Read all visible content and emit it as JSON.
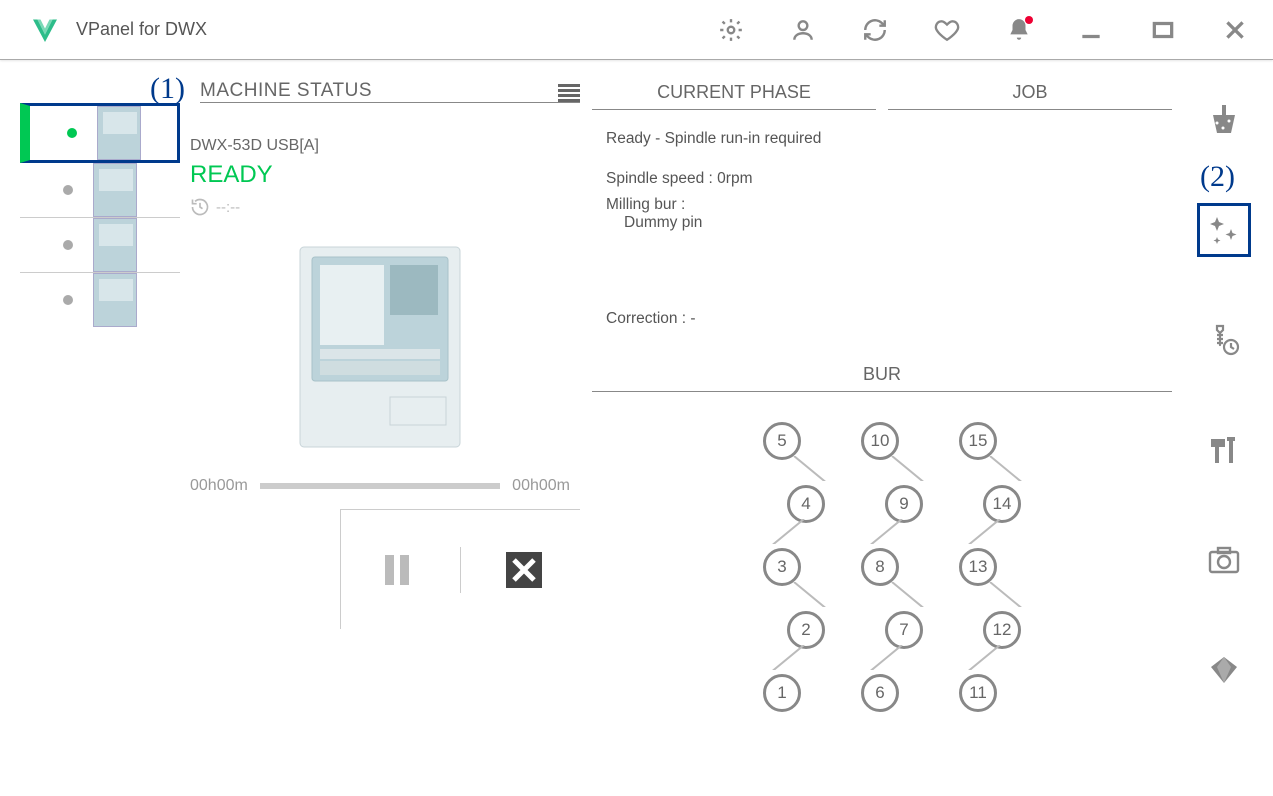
{
  "app_title": "VPanel for DWX",
  "annotations": {
    "one": "(1)",
    "two": "(2)"
  },
  "sections": {
    "machine_status": "MACHINE STATUS",
    "current_phase": "CURRENT PHASE",
    "job": "JOB",
    "bur": "BUR"
  },
  "machine": {
    "name": "DWX-53D USB[A]",
    "status": "READY",
    "elapsed": "--:--"
  },
  "progress": {
    "start": "00h00m",
    "end": "00h00m"
  },
  "phase": {
    "line1": "Ready - Spindle run-in required",
    "spindle_label": "Spindle speed : ",
    "spindle_value": "0rpm",
    "milling_label": "Milling bur :",
    "milling_value": "Dummy pin",
    "correction_label": "Correction : ",
    "correction_value": "-"
  },
  "bur": {
    "col1": [
      "5",
      "4",
      "3",
      "2",
      "1"
    ],
    "col2": [
      "10",
      "9",
      "8",
      "7",
      "6"
    ],
    "col3": [
      "15",
      "14",
      "13",
      "12",
      "11"
    ]
  }
}
